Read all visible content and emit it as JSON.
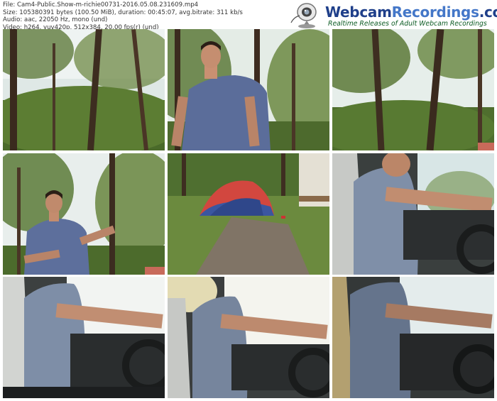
{
  "file_info": {
    "file": "File: Cam4-Public.Show-m-richie00731-2016.05.08.231609.mp4",
    "size": "Size: 105380391 bytes (100.50 MiB), duration: 00:45:07, avg.bitrate: 311 kb/s",
    "audio": "Audio: aac, 22050 Hz, mono (und)",
    "video": "Video: h264, yuv420p, 512x384, 20.00 fps(r) (und)"
  },
  "logo": {
    "title_part1": "Webcam",
    "title_part2": "Recordings",
    "title_part3": ".com",
    "subtitle": "Realtime Releases of Adult Webcam Recordings"
  },
  "colors": {
    "logo_dark_blue": "#1f3f8a",
    "logo_light_blue": "#4477c8",
    "logo_subtitle_green": "#0a5a22"
  },
  "thumbnails": [
    {
      "scene": "forest-trees"
    },
    {
      "scene": "man-in-forest"
    },
    {
      "scene": "forest-canopy"
    },
    {
      "scene": "man-under-trees"
    },
    {
      "scene": "tent-campsite"
    },
    {
      "scene": "man-driving"
    },
    {
      "scene": "car-interior-bright"
    },
    {
      "scene": "car-interior-glare"
    },
    {
      "scene": "car-interior-dark"
    }
  ]
}
